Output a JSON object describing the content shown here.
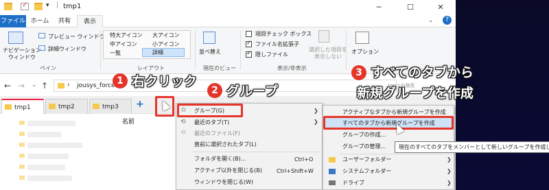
{
  "window": {
    "title": "tmp1",
    "controls": [
      "─",
      "☐",
      "✕"
    ],
    "help": "?"
  },
  "ribbon_tabs": [
    "ファイル",
    "ホーム",
    "共有",
    "表示"
  ],
  "ribbon": {
    "pane_nav": "ナビゲーション\nウィンドウ",
    "preview": "プレビュー ウィンドウ",
    "details_pane": "詳細ウィンドウ",
    "pane_group": "ペイン",
    "layout_items": [
      "特大アイコン",
      "大アイコン",
      "中アイコン",
      "小アイコン",
      "一覧",
      "詳細"
    ],
    "layout_group": "レイアウト",
    "sort": "並べ替え",
    "current_view_group": "現在のビュー",
    "item_checkbox": "項目チェック ボックス",
    "file_ext": "ファイル名拡張子",
    "hidden_items": "隠しファイル",
    "hide_selected": "選択した項目を\n表示しない",
    "showhide_group": "表示/非表示",
    "options": "オプション"
  },
  "address": {
    "path": "jousys_force",
    "right_hint": "tmp1の検索"
  },
  "tabs": [
    {
      "label": "tmp1"
    },
    {
      "label": "tmp2"
    },
    {
      "label": "tmp3"
    }
  ],
  "add_tab": "+",
  "column_header": "名前",
  "tree_placeholders": [
    "-",
    "-",
    "-",
    "-",
    "-",
    "-",
    "-",
    "-"
  ],
  "context_menu": {
    "items": [
      {
        "label": "グループ(G)",
        "shortcut": "",
        "arrow": "❯",
        "disabled": false
      },
      {
        "label": "最近のタブ(T)",
        "shortcut": "",
        "arrow": "❯",
        "disabled": false
      },
      {
        "label": "最近のファイル(F)",
        "shortcut": "",
        "arrow": "",
        "disabled": true
      },
      {
        "label": "直前に選択されたタブ(L)",
        "shortcut": "",
        "arrow": "",
        "disabled": false
      },
      {
        "label": "フォルダを開く(B)...",
        "shortcut": "Ctrl+O",
        "arrow": "",
        "disabled": false
      },
      {
        "label": "アクティブ以外を閉じる(B)",
        "shortcut": "Ctrl+Shift+W",
        "arrow": "",
        "disabled": false
      },
      {
        "label": "ウィンドウを閉じる(W)",
        "shortcut": "",
        "arrow": "",
        "disabled": false
      }
    ]
  },
  "submenu": {
    "items": [
      {
        "label": "アクティブなタブから新規グループを作成"
      },
      {
        "label": "すべてのタブから新規グループを作成"
      },
      {
        "label": "グループの作成..."
      },
      {
        "label": "グループの管理..."
      },
      {
        "label": "ユーザーフォルダー",
        "arrow": "❯"
      },
      {
        "label": "システムフォルダー",
        "arrow": "❯"
      },
      {
        "label": "ドライブ",
        "arrow": "❯"
      }
    ]
  },
  "tooltip": "現在のすべてのタブをメンバーとして新しいグループを作成します。",
  "annotations": {
    "step1_num": "1",
    "step1_text": "右クリック",
    "step2_num": "2",
    "step2_text": "グループ",
    "step3_num": "3",
    "step3_line1": "すべてのタブから",
    "step3_line2": "新規グループを作成"
  },
  "colors": {
    "accent": "#1e6fc8",
    "highlight": "#e5342a",
    "bg_dark": "#0a0a28"
  }
}
